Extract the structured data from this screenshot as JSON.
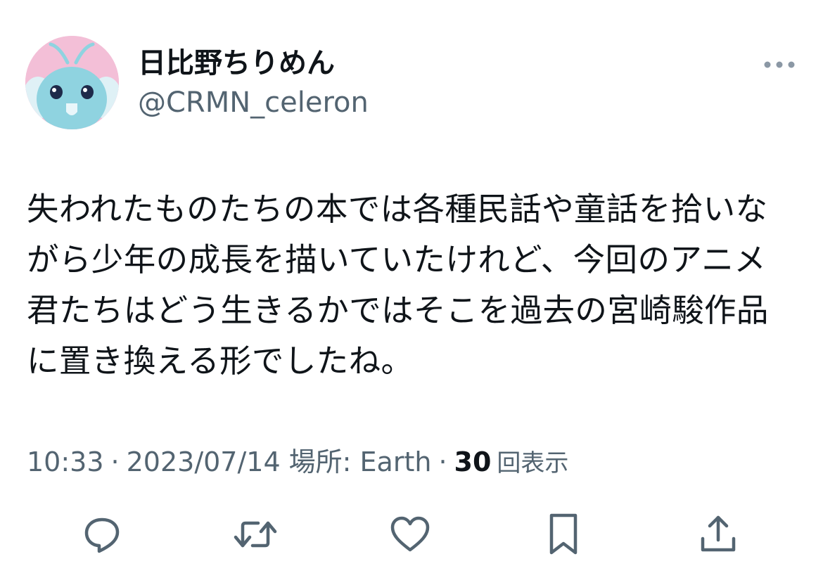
{
  "author": {
    "display_name": "日比野ちりめん",
    "handle": "@CRMN_celeron",
    "avatar_icon": "bird-character-avatar"
  },
  "more_icon": "more-horizontal-icon",
  "tweet": {
    "lines": [
      "失われたものたちの本では各種民話や童話を拾いな",
      "がら少年の成長を描いていたけれど、今回のアニメ",
      "君たちはどう生きるかではそこを過去の宮崎駿作品",
      "に置き換える形でしたね。"
    ]
  },
  "meta": {
    "time": "10:33",
    "separator": "·",
    "date": "2023/07/14",
    "location_label": "場所: Earth",
    "views_count": "30",
    "views_label": "回表示"
  },
  "actions": [
    {
      "name": "reply",
      "icon": "reply-icon"
    },
    {
      "name": "retweet",
      "icon": "retweet-icon"
    },
    {
      "name": "like",
      "icon": "heart-icon"
    },
    {
      "name": "bookmark",
      "icon": "bookmark-icon"
    },
    {
      "name": "share",
      "icon": "share-icon"
    }
  ],
  "colors": {
    "text_primary": "#0f1419",
    "text_secondary": "#536471",
    "avatar_bg": "#f3bfd7",
    "avatar_body": "#8fd3e0"
  }
}
